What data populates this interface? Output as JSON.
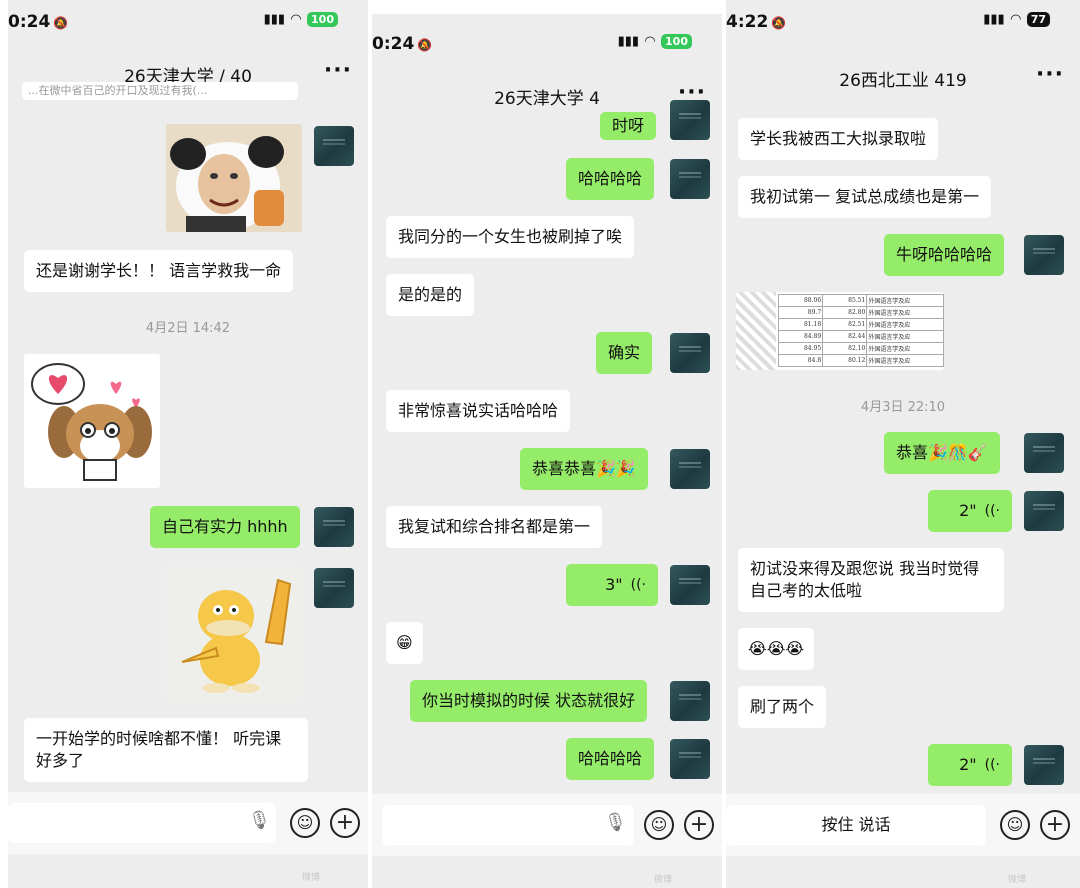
{
  "colors": {
    "outgoing_bubble": "#95ec69",
    "incoming_bubble": "#ffffff",
    "chat_background": "#ededed",
    "battery_green": "#34c759"
  },
  "panel1": {
    "status": {
      "time": "0:24",
      "battery": "100"
    },
    "title": "26天津大学 /    40",
    "cut_off_text": "...在微中省百己的开口及现过有我(...",
    "messages": {
      "m1": "还是谢谢学长！！ 语言学救我一命",
      "ts": "4月2日 14:42",
      "m2": "自己有实力 hhhh",
      "m3": "一开始学的时候啥都不懂！ 听完课好多了"
    },
    "stickers": {
      "s1": "panda-face-sticker",
      "s2": "puppy-hearts-sticker",
      "s3": "psyduck-thumbs-up-sticker"
    }
  },
  "panel2": {
    "status": {
      "time": "0:24",
      "battery": "100"
    },
    "title": "26天津大学       4",
    "messages": {
      "m0": "时呀",
      "m1": "哈哈哈哈",
      "m2": "我同分的一个女生也被刷掉了唉",
      "m3": "是的是的",
      "m4": "确实",
      "m5": "非常惊喜说实话哈哈哈",
      "m6": "恭喜恭喜🎉🎉",
      "m7": "我复试和综合排名都是第一",
      "m8": "3\"",
      "m9": "😁",
      "m10": "你当时模拟的时候 状态就很好",
      "m11": "哈哈哈哈"
    }
  },
  "panel3": {
    "status": {
      "time": "4:22",
      "battery": "77"
    },
    "title": "26西北工业     419",
    "messages": {
      "m1": "学长我被西工大拟录取啦",
      "m2": "我初试第一 复试总成绩也是第一",
      "m3": "牛呀哈哈哈哈",
      "ts": "4月3日 22:10",
      "m4": "恭喜🎉🎊🎸",
      "m5": "2\"",
      "m6": "初试没来得及跟您说 我当时觉得自己考的太低啦",
      "m7": "😭😭😭",
      "m8": "刷了两个",
      "m9": "2\""
    },
    "score_table": {
      "rows": [
        [
          "88.06",
          "85.51",
          "外国语言学及应"
        ],
        [
          "89.7",
          "82.80",
          "外国语言学及应"
        ],
        [
          "81.18",
          "82.51",
          "外国语言学及应"
        ],
        [
          "84.89",
          "82.44",
          "外国语言学及应"
        ],
        [
          "84.95",
          "82.10",
          "外国语言学及应"
        ],
        [
          "84.8",
          "80.12",
          "外国语言学及应"
        ]
      ]
    },
    "press_to_talk": "按住 说话"
  }
}
